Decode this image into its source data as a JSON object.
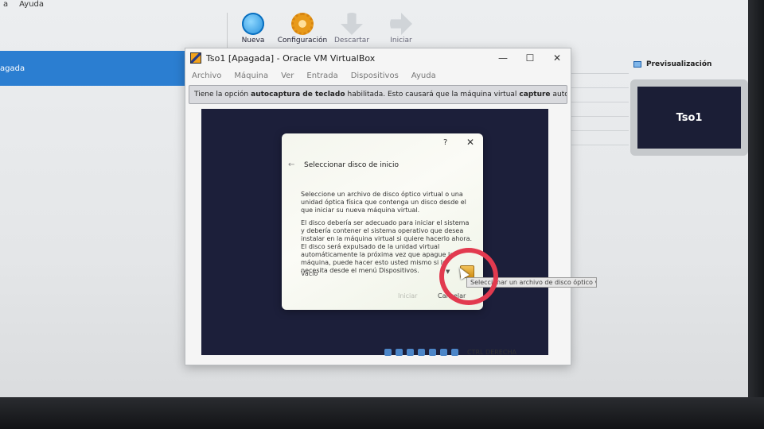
{
  "manager": {
    "menu": [
      "a",
      "Ayuda"
    ],
    "toolbar": {
      "new_label": "Nueva",
      "settings_label": "Configuración",
      "discard_label": "Descartar",
      "start_label": "Iniciar"
    },
    "sidebar_selected": "agada",
    "preview": {
      "title": "Previsualización",
      "vm_name": "Tso1"
    }
  },
  "vm_window": {
    "title": "Tso1 [Apagada] - Oracle VM VirtualBox",
    "menu": [
      "Archivo",
      "Máquina",
      "Ver",
      "Entrada",
      "Dispositivos",
      "Ayuda"
    ],
    "notice": {
      "text_before": "Tiene la opción",
      "bold1": "autocaptura de teclado",
      "text_middle": "habilitada. Esto causará que la máquina virtual",
      "bold2": "capture",
      "text_after": "automáticamente"
    },
    "host_key": "CTRL DERECHA"
  },
  "dialog": {
    "help": "?",
    "close": "✕",
    "back": "←",
    "title": "Seleccionar disco de inicio",
    "paragraph1": "Seleccione un archivo de disco óptico virtual o una unidad óptica física que contenga un disco desde el que iniciar su nueva máquina virtual.",
    "paragraph2": "El disco debería ser adecuado para iniciar el sistema y debería contener el sistema operativo que desea instalar en la máquina virtual si quiere hacerlo ahora. El disco será expulsado de la unidad virtual automáticamente la próxima vez que apague la máquina, puede hacer esto usted mismo si lo necesita desde el menú Dispositivos.",
    "combo_value": "Vacío",
    "start_button": "Iniciar",
    "cancel_button": "Cancelar",
    "tooltip": "Seleccionar un archivo de disco óptico virtual..."
  },
  "colors": {
    "selection": "#2b7ed1",
    "vm_screen": "#1c1f3a",
    "highlight": "#e23a4f"
  }
}
